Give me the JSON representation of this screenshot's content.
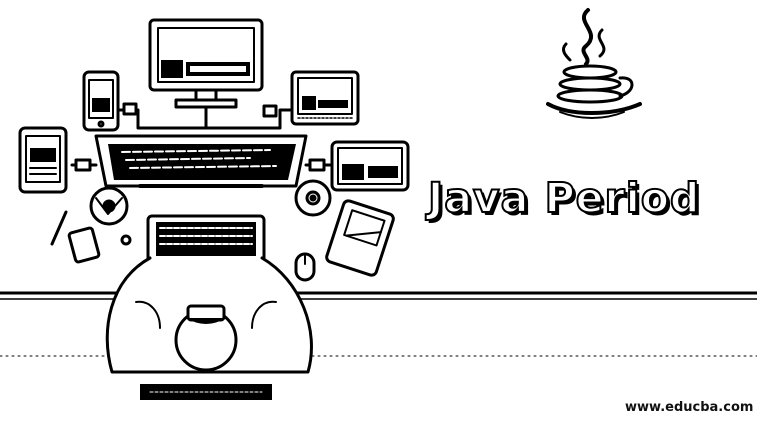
{
  "banner": {
    "title": "Java Period",
    "url": "www.educba.com"
  },
  "colors": {
    "background": "#ffffff",
    "ink": "#000000"
  },
  "icons": [
    "java-logo-icon",
    "desktop-monitor-icon",
    "smartphone-icon",
    "tablet-icon",
    "laptop-icon",
    "keyboard-icon",
    "calculator-icon",
    "mouse-icon",
    "cd-icon",
    "person-icon"
  ]
}
